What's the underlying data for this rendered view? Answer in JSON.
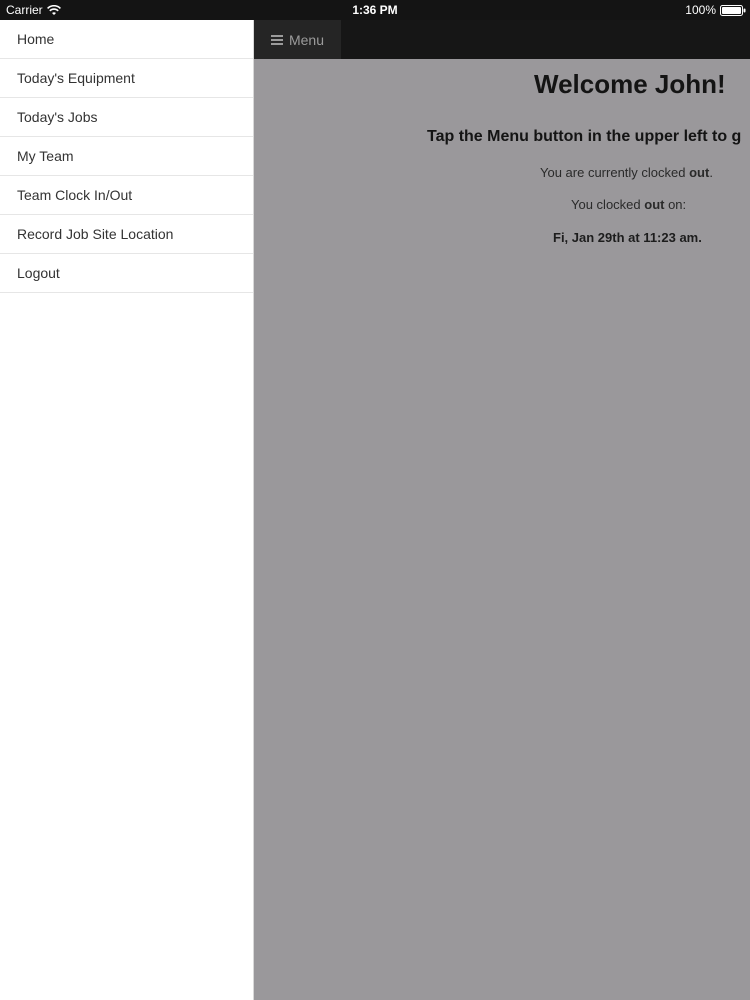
{
  "status_bar": {
    "carrier": "Carrier",
    "time": "1:36 PM",
    "battery": "100%"
  },
  "side_menu": {
    "items": [
      {
        "label": "Home"
      },
      {
        "label": "Today's Equipment"
      },
      {
        "label": "Today's Jobs"
      },
      {
        "label": "My Team"
      },
      {
        "label": "Team Clock In/Out"
      },
      {
        "label": "Record Job Site Location"
      },
      {
        "label": "Logout"
      }
    ]
  },
  "nav_bar": {
    "menu_label": "Menu",
    "menu_icon": "hamburger-icon"
  },
  "content": {
    "welcome": "Welcome John!",
    "instruction": "Tap the Menu button in the upper left to g",
    "clocked_status_prefix": "You are currently clocked ",
    "clocked_status_value": "out",
    "clocked_status_suffix": ".",
    "clocked_on_prefix": "You clocked ",
    "clocked_on_value": "out",
    "clocked_on_suffix": " on:",
    "clock_time": "Fi, Jan 29th at 11:23 am."
  },
  "colors": {
    "status_bar_bg": "#141414",
    "nav_bar_bg": "#161616",
    "menu_button_bg": "#252525",
    "content_overlay_bg": "#9a989b",
    "side_menu_bg": "#ffffff"
  }
}
